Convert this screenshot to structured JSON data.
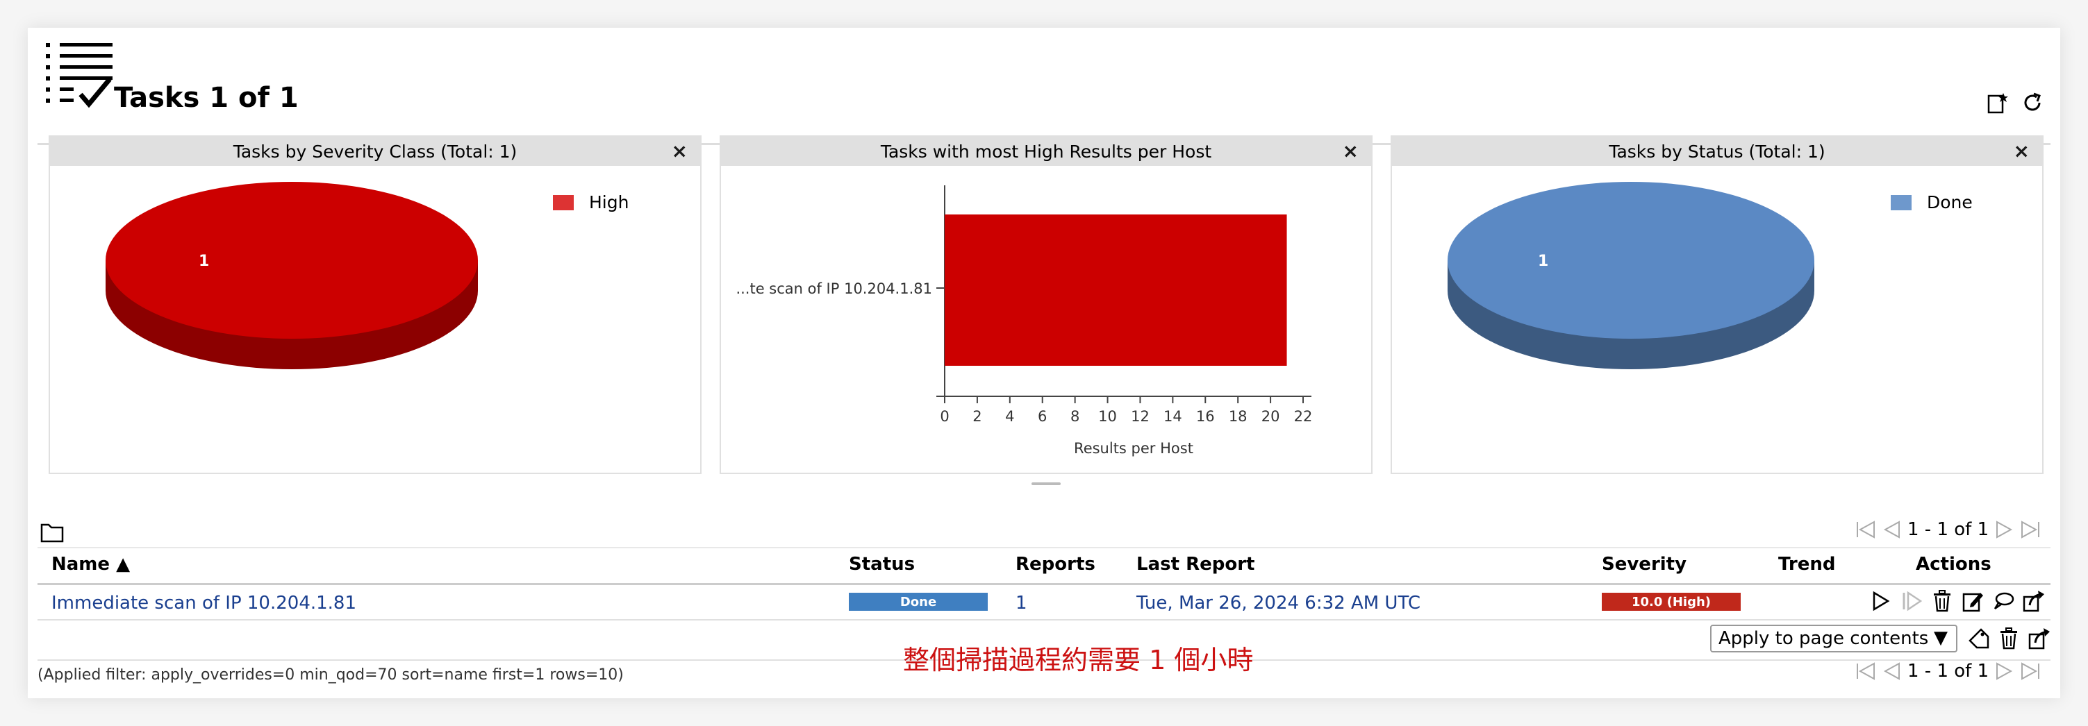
{
  "page": {
    "title": "Tasks 1 of 1"
  },
  "charts": {
    "severity": {
      "heading": "Tasks by Severity Class (Total: 1)",
      "close": "×",
      "legend": "High",
      "slice_label": "1",
      "color": "#cc0000"
    },
    "high_results": {
      "heading": "Tasks with most High Results per Host",
      "close": "×",
      "category_label": "...te scan of IP 10.204.1.81",
      "ticks": [
        "0",
        "2",
        "4",
        "6",
        "8",
        "10",
        "12",
        "14",
        "16",
        "18",
        "20",
        "22"
      ],
      "xlabel": "Results per Host",
      "color": "#cc0000"
    },
    "status": {
      "heading": "Tasks by Status (Total: 1)",
      "close": "×",
      "legend": "Done",
      "slice_label": "1",
      "color": "#5b89c4"
    }
  },
  "chart_data": [
    {
      "type": "pie",
      "title": "Tasks by Severity Class (Total: 1)",
      "categories": [
        "High"
      ],
      "values": [
        1
      ]
    },
    {
      "type": "bar",
      "title": "Tasks with most High Results per Host",
      "categories": [
        "...te scan of IP 10.204.1.81"
      ],
      "values": [
        21
      ],
      "xlabel": "Results per Host",
      "xlim": [
        0,
        22
      ],
      "orientation": "horizontal"
    },
    {
      "type": "pie",
      "title": "Tasks by Status (Total: 1)",
      "categories": [
        "Done"
      ],
      "values": [
        1
      ]
    }
  ],
  "pager": {
    "text": "1 - 1 of 1"
  },
  "table": {
    "headers": {
      "name": "Name ▲",
      "status": "Status",
      "reports": "Reports",
      "last_report": "Last Report",
      "severity": "Severity",
      "trend": "Trend",
      "actions": "Actions"
    },
    "rows": [
      {
        "name": "Immediate scan of IP 10.204.1.81",
        "status": "Done",
        "status_progress": 1.0,
        "reports": "1",
        "last_report": "Tue, Mar 26, 2024 6:32 AM UTC",
        "severity": "10.0 (High)",
        "severity_color": "#c0281b",
        "status_color": "#3f7fc1"
      }
    ]
  },
  "bulk": {
    "apply_label": "Apply to page contents",
    "arrow": "▼"
  },
  "filter_text": "(Applied filter: apply_overrides=0 min_qod=70 sort=name first=1 rows=10)",
  "overlay_note": "整個掃描過程約需要 1 個小時"
}
